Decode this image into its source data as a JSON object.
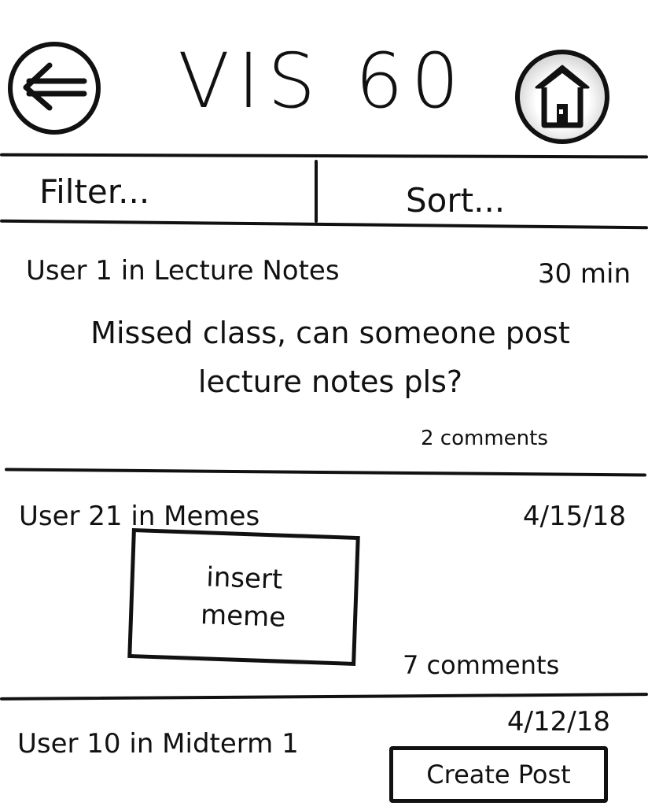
{
  "header": {
    "title": "VIS 60",
    "back_icon": "back-arrow-icon",
    "home_icon": "home-icon"
  },
  "toolbar": {
    "filter_label": "Filter...",
    "sort_label": "Sort..."
  },
  "posts": [
    {
      "author": "User 1 in Lecture Notes",
      "time": "30 min",
      "body": "Missed class, can someone post lecture notes pls?",
      "comments": "2 comments"
    },
    {
      "author": "User 21 in Memes",
      "time": "4/15/18",
      "meme_line_1": "insert",
      "meme_line_2": "meme",
      "comments": "7 comments"
    },
    {
      "author": "User 10 in Midterm 1",
      "time": "4/12/18"
    }
  ],
  "actions": {
    "create_post_label": "Create Post"
  }
}
